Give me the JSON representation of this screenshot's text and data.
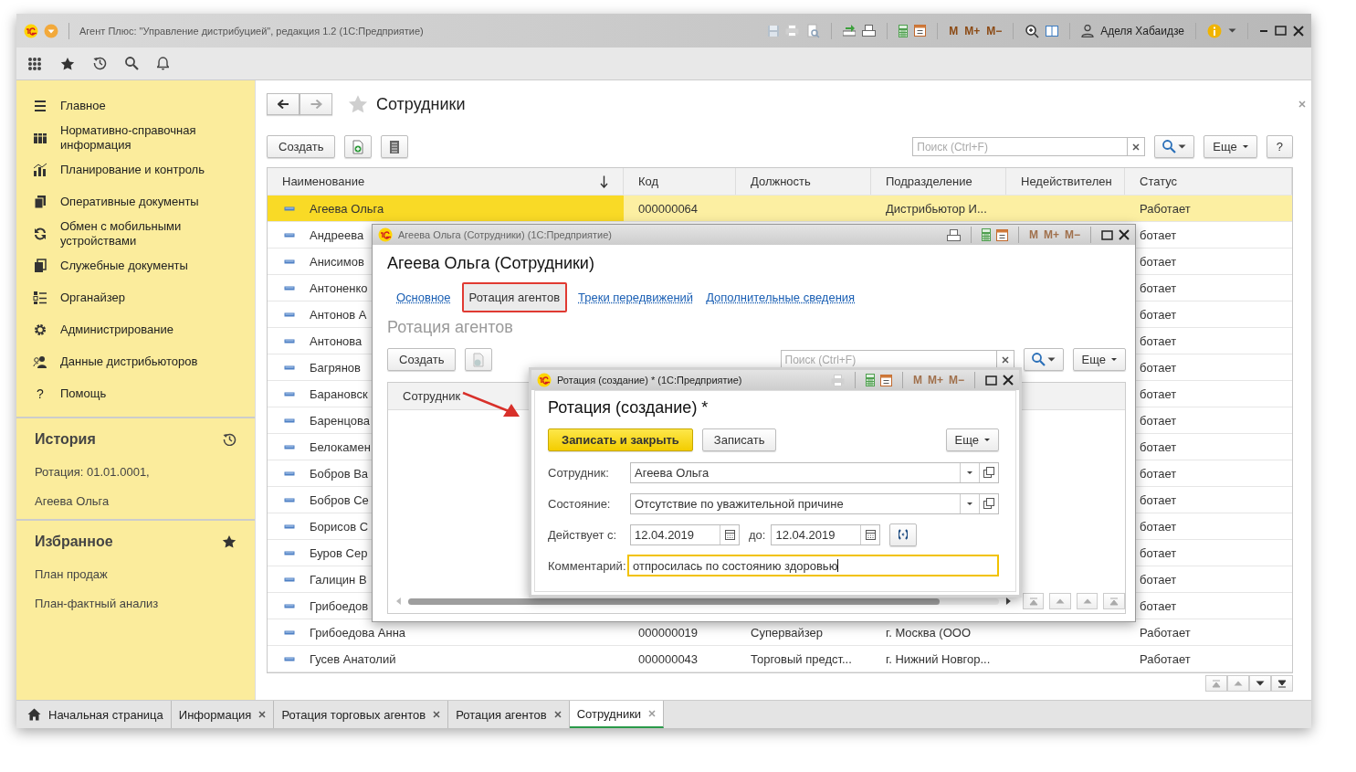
{
  "app": {
    "title": "Агент Плюс: \"Управление дистрибуцией\", редакция 1.2  (1С:Предприятие)",
    "memory_keys": [
      "M",
      "M+",
      "M−"
    ],
    "user": "Аделя Хабаидзе"
  },
  "sidebar": {
    "items": [
      {
        "label": "Главное"
      },
      {
        "label": "Нормативно-справочная информация"
      },
      {
        "label": "Планирование и контроль"
      },
      {
        "label": "Оперативные документы"
      },
      {
        "label": "Обмен с мобильными устройствами"
      },
      {
        "label": "Служебные документы"
      },
      {
        "label": "Органайзер"
      },
      {
        "label": "Администрирование"
      },
      {
        "label": "Данные дистрибьюторов"
      },
      {
        "label": "Помощь",
        "glyph": "?"
      }
    ]
  },
  "history": {
    "title": "История",
    "items": [
      "Ротация: 01.01.0001,",
      "Агеева Ольга"
    ]
  },
  "favorites": {
    "title": "Избранное",
    "items": [
      "План продаж",
      "План-фактный анализ"
    ]
  },
  "page": {
    "title": "Сотрудники",
    "create": "Создать",
    "search_placeholder": "Поиск (Ctrl+F)",
    "more": "Еще",
    "help": "?"
  },
  "table": {
    "columns": [
      {
        "label": "Наименование",
        "sorted": true
      },
      {
        "label": "Код"
      },
      {
        "label": "Должность"
      },
      {
        "label": "Подразделение"
      },
      {
        "label": "Недействителен"
      },
      {
        "label": "Статус"
      }
    ],
    "rows": [
      {
        "selected": true,
        "name": "Агеева Ольга",
        "code": "000000064",
        "department": "Дистрибьютор И...",
        "status": "Работает"
      },
      {
        "selected": false,
        "name": "Андреева",
        "status": "ботает"
      },
      {
        "selected": false,
        "name": "Анисимов",
        "status": "ботает"
      },
      {
        "selected": false,
        "name": "Антоненко",
        "status": "ботает"
      },
      {
        "selected": false,
        "name": "Антонов А",
        "status": "ботает"
      },
      {
        "selected": false,
        "name": "Антонова",
        "status": "ботает"
      },
      {
        "selected": false,
        "name": "Багрянов",
        "status": "ботает"
      },
      {
        "selected": false,
        "name": "Барановск",
        "status": "ботает"
      },
      {
        "selected": false,
        "name": "Баренцова",
        "status": "ботает"
      },
      {
        "selected": false,
        "name": "Белокамен",
        "status": "ботает"
      },
      {
        "selected": false,
        "name": "Бобров Ва",
        "status": "ботает"
      },
      {
        "selected": false,
        "name": "Бобров Се",
        "status": "ботает"
      },
      {
        "selected": false,
        "name": "Борисов С",
        "status": "ботает"
      },
      {
        "selected": false,
        "name": "Буров Сер",
        "status": "ботает"
      },
      {
        "selected": false,
        "name": "Галицин В",
        "status": "ботает"
      },
      {
        "selected": false,
        "name": "Грибоедов",
        "status": "ботает"
      },
      {
        "selected": false,
        "name": "Грибоедова Анна",
        "code": "000000019",
        "position": "Супервайзер",
        "department": "г. Москва (ООО",
        "status": "Работает"
      },
      {
        "selected": false,
        "name": "Гусев Анатолий",
        "code": "000000043",
        "position": "Торговый предст...",
        "department": "г. Нижний Новгор...",
        "status": "Работает"
      }
    ]
  },
  "record_window": {
    "title": "Агеева Ольга (Сотрудники)  (1С:Предприятие)",
    "memory_keys": [
      "M",
      "M+",
      "M−"
    ],
    "heading": "Агеева Ольга (Сотрудники)",
    "tabs": [
      {
        "label": "Основное",
        "selected": false,
        "callout": false
      },
      {
        "label": "Ротация агентов",
        "selected": true,
        "callout": true
      },
      {
        "label": "Треки передвижений",
        "selected": false,
        "callout": false
      },
      {
        "label": "Дополнительные сведения",
        "selected": false,
        "callout": false
      }
    ],
    "section_title": "Ротация агентов",
    "create": "Создать",
    "search_placeholder": "Поиск (Ctrl+F)",
    "more": "Еще",
    "columns": [
      "Сотрудник"
    ]
  },
  "rotation_dialog": {
    "title": "Ротация (создание) *  (1С:Предприятие)",
    "memory_keys": [
      "M",
      "M+",
      "M−"
    ],
    "heading": "Ротация (создание) *",
    "save_close": "Записать и закрыть",
    "save": "Записать",
    "more": "Еще",
    "fields": [
      {
        "label": "Сотрудник:",
        "value": "Агеева Ольга"
      },
      {
        "label": "Состояние:",
        "value": "Отсутствие по уважительной причине"
      }
    ],
    "period": {
      "from_label": "Действует с:",
      "from": "12.04.2019",
      "to_label": "до:",
      "to": "12.04.2019"
    },
    "comment": {
      "label": "Комментарий:",
      "value": "отпросилась по состоянию здоровью",
      "focused": true
    }
  },
  "tabs_bar": [
    {
      "label": "Начальная страница",
      "kind": "home",
      "selected": false
    },
    {
      "label": "Информация",
      "kind": "closable",
      "selected": false
    },
    {
      "label": "Ротация торговых агентов",
      "kind": "closable",
      "selected": false
    },
    {
      "label": "Ротация агентов",
      "kind": "closable",
      "selected": false
    },
    {
      "label": "Сотрудники",
      "kind": "closable",
      "selected": true
    }
  ]
}
